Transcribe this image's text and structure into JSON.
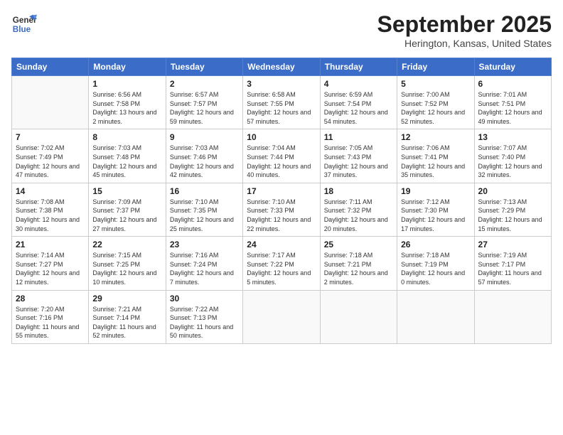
{
  "logo": {
    "line1": "General",
    "line2": "Blue"
  },
  "title": "September 2025",
  "location": "Herington, Kansas, United States",
  "weekdays": [
    "Sunday",
    "Monday",
    "Tuesday",
    "Wednesday",
    "Thursday",
    "Friday",
    "Saturday"
  ],
  "weeks": [
    [
      {
        "day": "",
        "sunrise": "",
        "sunset": "",
        "daylight": ""
      },
      {
        "day": "1",
        "sunrise": "Sunrise: 6:56 AM",
        "sunset": "Sunset: 7:58 PM",
        "daylight": "Daylight: 13 hours and 2 minutes."
      },
      {
        "day": "2",
        "sunrise": "Sunrise: 6:57 AM",
        "sunset": "Sunset: 7:57 PM",
        "daylight": "Daylight: 12 hours and 59 minutes."
      },
      {
        "day": "3",
        "sunrise": "Sunrise: 6:58 AM",
        "sunset": "Sunset: 7:55 PM",
        "daylight": "Daylight: 12 hours and 57 minutes."
      },
      {
        "day": "4",
        "sunrise": "Sunrise: 6:59 AM",
        "sunset": "Sunset: 7:54 PM",
        "daylight": "Daylight: 12 hours and 54 minutes."
      },
      {
        "day": "5",
        "sunrise": "Sunrise: 7:00 AM",
        "sunset": "Sunset: 7:52 PM",
        "daylight": "Daylight: 12 hours and 52 minutes."
      },
      {
        "day": "6",
        "sunrise": "Sunrise: 7:01 AM",
        "sunset": "Sunset: 7:51 PM",
        "daylight": "Daylight: 12 hours and 49 minutes."
      }
    ],
    [
      {
        "day": "7",
        "sunrise": "Sunrise: 7:02 AM",
        "sunset": "Sunset: 7:49 PM",
        "daylight": "Daylight: 12 hours and 47 minutes."
      },
      {
        "day": "8",
        "sunrise": "Sunrise: 7:03 AM",
        "sunset": "Sunset: 7:48 PM",
        "daylight": "Daylight: 12 hours and 45 minutes."
      },
      {
        "day": "9",
        "sunrise": "Sunrise: 7:03 AM",
        "sunset": "Sunset: 7:46 PM",
        "daylight": "Daylight: 12 hours and 42 minutes."
      },
      {
        "day": "10",
        "sunrise": "Sunrise: 7:04 AM",
        "sunset": "Sunset: 7:44 PM",
        "daylight": "Daylight: 12 hours and 40 minutes."
      },
      {
        "day": "11",
        "sunrise": "Sunrise: 7:05 AM",
        "sunset": "Sunset: 7:43 PM",
        "daylight": "Daylight: 12 hours and 37 minutes."
      },
      {
        "day": "12",
        "sunrise": "Sunrise: 7:06 AM",
        "sunset": "Sunset: 7:41 PM",
        "daylight": "Daylight: 12 hours and 35 minutes."
      },
      {
        "day": "13",
        "sunrise": "Sunrise: 7:07 AM",
        "sunset": "Sunset: 7:40 PM",
        "daylight": "Daylight: 12 hours and 32 minutes."
      }
    ],
    [
      {
        "day": "14",
        "sunrise": "Sunrise: 7:08 AM",
        "sunset": "Sunset: 7:38 PM",
        "daylight": "Daylight: 12 hours and 30 minutes."
      },
      {
        "day": "15",
        "sunrise": "Sunrise: 7:09 AM",
        "sunset": "Sunset: 7:37 PM",
        "daylight": "Daylight: 12 hours and 27 minutes."
      },
      {
        "day": "16",
        "sunrise": "Sunrise: 7:10 AM",
        "sunset": "Sunset: 7:35 PM",
        "daylight": "Daylight: 12 hours and 25 minutes."
      },
      {
        "day": "17",
        "sunrise": "Sunrise: 7:10 AM",
        "sunset": "Sunset: 7:33 PM",
        "daylight": "Daylight: 12 hours and 22 minutes."
      },
      {
        "day": "18",
        "sunrise": "Sunrise: 7:11 AM",
        "sunset": "Sunset: 7:32 PM",
        "daylight": "Daylight: 12 hours and 20 minutes."
      },
      {
        "day": "19",
        "sunrise": "Sunrise: 7:12 AM",
        "sunset": "Sunset: 7:30 PM",
        "daylight": "Daylight: 12 hours and 17 minutes."
      },
      {
        "day": "20",
        "sunrise": "Sunrise: 7:13 AM",
        "sunset": "Sunset: 7:29 PM",
        "daylight": "Daylight: 12 hours and 15 minutes."
      }
    ],
    [
      {
        "day": "21",
        "sunrise": "Sunrise: 7:14 AM",
        "sunset": "Sunset: 7:27 PM",
        "daylight": "Daylight: 12 hours and 12 minutes."
      },
      {
        "day": "22",
        "sunrise": "Sunrise: 7:15 AM",
        "sunset": "Sunset: 7:25 PM",
        "daylight": "Daylight: 12 hours and 10 minutes."
      },
      {
        "day": "23",
        "sunrise": "Sunrise: 7:16 AM",
        "sunset": "Sunset: 7:24 PM",
        "daylight": "Daylight: 12 hours and 7 minutes."
      },
      {
        "day": "24",
        "sunrise": "Sunrise: 7:17 AM",
        "sunset": "Sunset: 7:22 PM",
        "daylight": "Daylight: 12 hours and 5 minutes."
      },
      {
        "day": "25",
        "sunrise": "Sunrise: 7:18 AM",
        "sunset": "Sunset: 7:21 PM",
        "daylight": "Daylight: 12 hours and 2 minutes."
      },
      {
        "day": "26",
        "sunrise": "Sunrise: 7:18 AM",
        "sunset": "Sunset: 7:19 PM",
        "daylight": "Daylight: 12 hours and 0 minutes."
      },
      {
        "day": "27",
        "sunrise": "Sunrise: 7:19 AM",
        "sunset": "Sunset: 7:17 PM",
        "daylight": "Daylight: 11 hours and 57 minutes."
      }
    ],
    [
      {
        "day": "28",
        "sunrise": "Sunrise: 7:20 AM",
        "sunset": "Sunset: 7:16 PM",
        "daylight": "Daylight: 11 hours and 55 minutes."
      },
      {
        "day": "29",
        "sunrise": "Sunrise: 7:21 AM",
        "sunset": "Sunset: 7:14 PM",
        "daylight": "Daylight: 11 hours and 52 minutes."
      },
      {
        "day": "30",
        "sunrise": "Sunrise: 7:22 AM",
        "sunset": "Sunset: 7:13 PM",
        "daylight": "Daylight: 11 hours and 50 minutes."
      },
      {
        "day": "",
        "sunrise": "",
        "sunset": "",
        "daylight": ""
      },
      {
        "day": "",
        "sunrise": "",
        "sunset": "",
        "daylight": ""
      },
      {
        "day": "",
        "sunrise": "",
        "sunset": "",
        "daylight": ""
      },
      {
        "day": "",
        "sunrise": "",
        "sunset": "",
        "daylight": ""
      }
    ]
  ]
}
